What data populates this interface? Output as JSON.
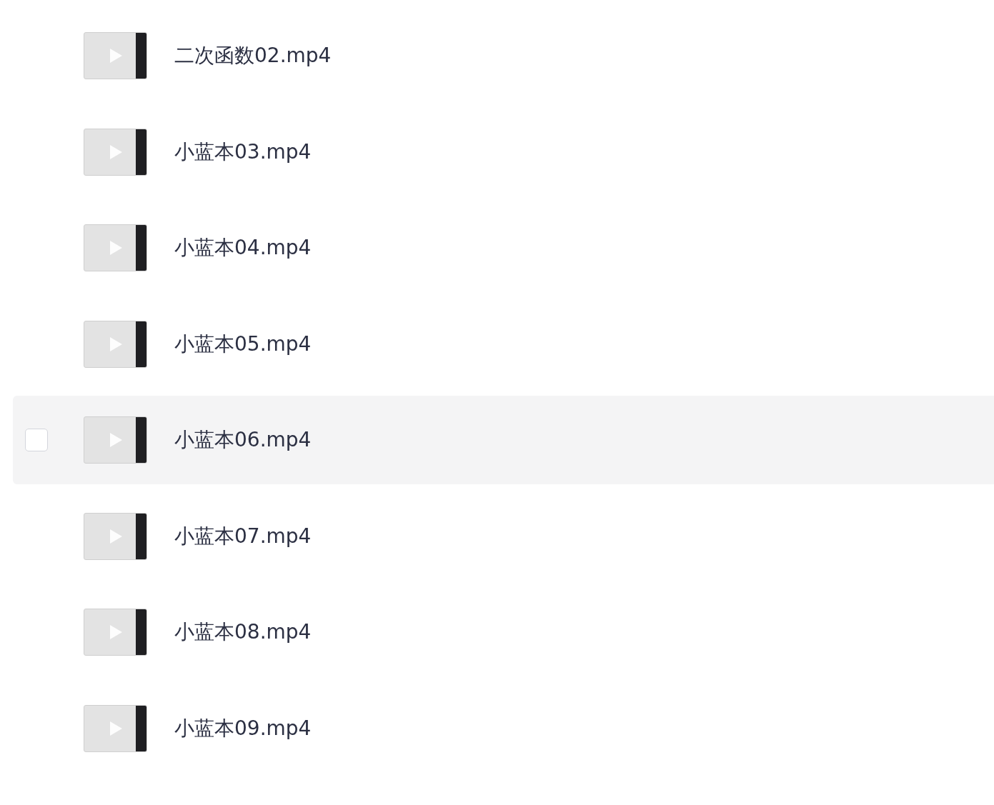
{
  "files": [
    {
      "name": "二次函数02.mp4",
      "hovered": false,
      "checked": false
    },
    {
      "name": "小蓝本03.mp4",
      "hovered": false,
      "checked": false
    },
    {
      "name": "小蓝本04.mp4",
      "hovered": false,
      "checked": false
    },
    {
      "name": "小蓝本05.mp4",
      "hovered": false,
      "checked": false
    },
    {
      "name": "小蓝本06.mp4",
      "hovered": true,
      "checked": false
    },
    {
      "name": "小蓝本07.mp4",
      "hovered": false,
      "checked": false
    },
    {
      "name": "小蓝本08.mp4",
      "hovered": false,
      "checked": false
    },
    {
      "name": "小蓝本09.mp4",
      "hovered": false,
      "checked": false
    }
  ]
}
